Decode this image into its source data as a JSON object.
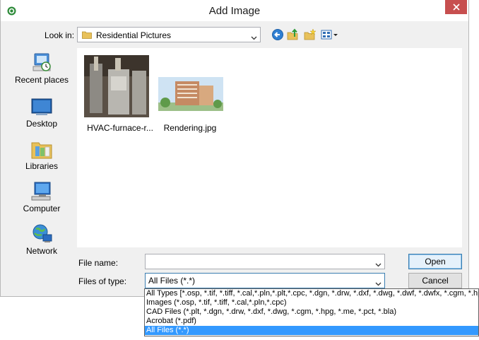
{
  "window": {
    "title": "Add Image"
  },
  "lookin": {
    "label": "Look in:",
    "value": "Residential Pictures"
  },
  "places": [
    {
      "label": "Recent places"
    },
    {
      "label": "Desktop"
    },
    {
      "label": "Libraries"
    },
    {
      "label": "Computer"
    },
    {
      "label": "Network"
    }
  ],
  "files": [
    {
      "name": "HVAC-furnace-r..."
    },
    {
      "name": "Rendering.jpg"
    }
  ],
  "filename": {
    "label": "File name:",
    "value": ""
  },
  "filetype": {
    "label": "Files of type:",
    "value": "All Files (*.*)",
    "options": [
      "All Types [*.osp, *.tif, *.tiff, *.cal,*.pln,*.plt,*.cpc, *.dgn, *.drw, *.dxf, *.dwg, *.dwf, *.dwfx, *.cgm, *.hpg, *.me, *",
      "Images (*.osp, *.tif, *.tiff, *.cal,*.pln,*.cpc)",
      "CAD Files (*.plt, *.dgn, *.drw, *.dxf, *.dwg, *.cgm, *.hpg, *.me, *.pct, *.bla)",
      "Acrobat (*.pdf)",
      "All Files (*.*)"
    ]
  },
  "buttons": {
    "open": "Open",
    "cancel": "Cancel"
  },
  "colors": {
    "close": "#c74f4f",
    "selection": "#3399ff",
    "focus_border": "#3c7fb1"
  }
}
